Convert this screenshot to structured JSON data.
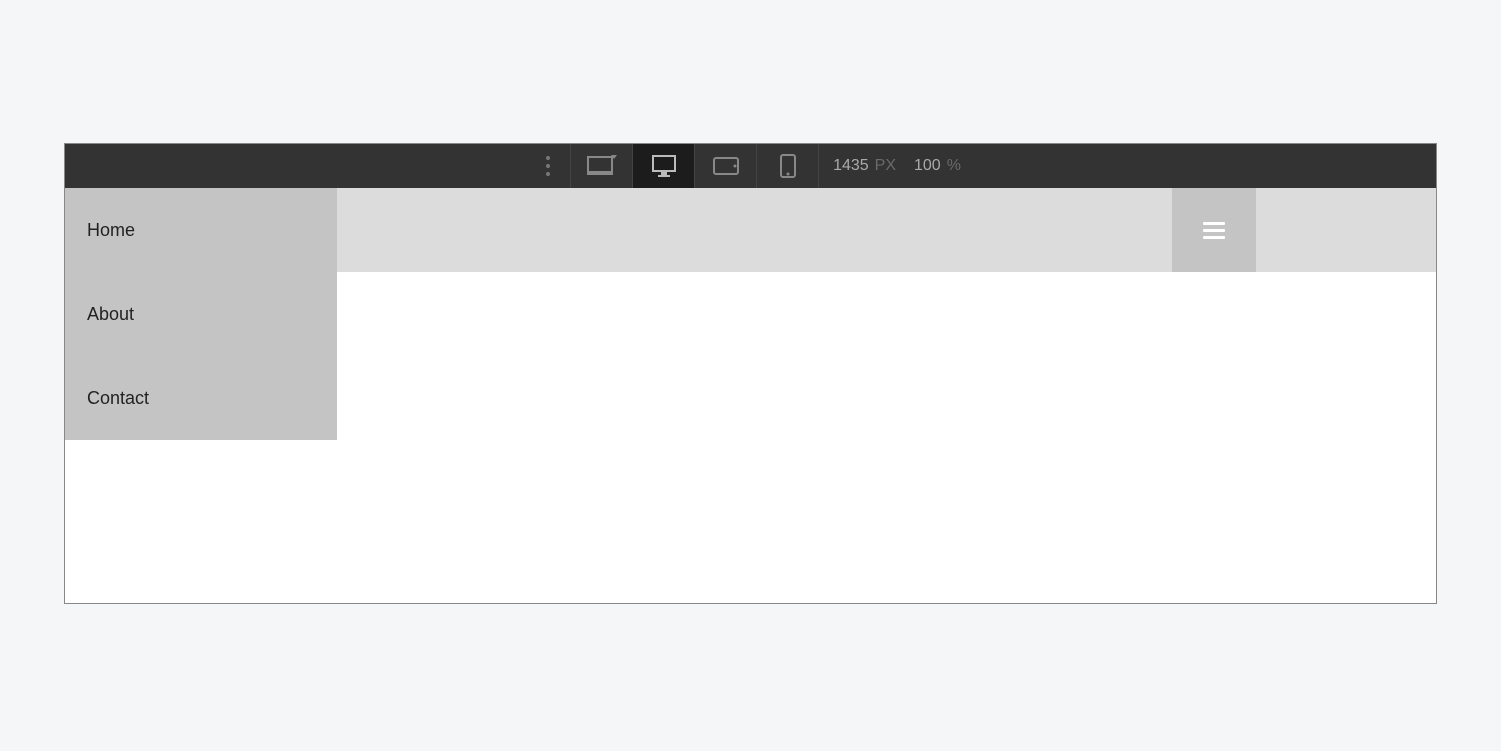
{
  "toolbar": {
    "width_value": "1435",
    "width_unit": "PX",
    "zoom_value": "100",
    "zoom_unit": "%"
  },
  "menu": {
    "items": [
      {
        "label": "Home"
      },
      {
        "label": "About"
      },
      {
        "label": "Contact"
      }
    ]
  }
}
